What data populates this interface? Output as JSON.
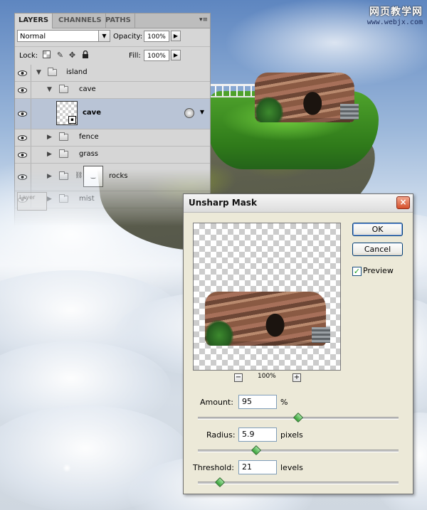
{
  "watermark": {
    "title": "网页教学网",
    "url": "www.webjx.com"
  },
  "layers_panel": {
    "tabs": [
      "LAYERS",
      "CHANNELS",
      "PATHS"
    ],
    "active_tab": "LAYERS",
    "blend_mode": "Normal",
    "opacity_label": "Opacity:",
    "opacity_value": "100%",
    "lock_label": "Lock:",
    "fill_label": "Fill:",
    "fill_value": "100%",
    "layers": [
      {
        "name": "island",
        "type": "group",
        "expanded": true,
        "indent": 0
      },
      {
        "name": "cave",
        "type": "group",
        "expanded": true,
        "indent": 1
      },
      {
        "name": "cave",
        "type": "smart-object",
        "selected": true,
        "indent": 2
      },
      {
        "name": "fence",
        "type": "group",
        "expanded": false,
        "indent": 1
      },
      {
        "name": "grass",
        "type": "group",
        "expanded": false,
        "indent": 1
      },
      {
        "name": "rocks",
        "type": "group-with-mask",
        "expanded": false,
        "indent": 1
      },
      {
        "name": "mist",
        "type": "group",
        "expanded": false,
        "indent": 1
      }
    ],
    "ghost_label": "Layer"
  },
  "dialog": {
    "title": "Unsharp Mask",
    "ok_label": "OK",
    "cancel_label": "Cancel",
    "preview_label": "Preview",
    "preview_checked": true,
    "zoom_value": "100%",
    "zoom_out_glyph": "−",
    "zoom_in_glyph": "+",
    "amount": {
      "label": "Amount:",
      "value": "95",
      "unit": "%",
      "slider_fraction": 0.5
    },
    "radius": {
      "label": "Radius:",
      "value": "5.9",
      "unit": "pixels",
      "slider_fraction": 0.29
    },
    "threshold": {
      "label": "Threshold:",
      "value": "21",
      "unit": "levels",
      "slider_fraction": 0.11
    }
  },
  "icons": {
    "close": "×",
    "panel_menu": "▾≡",
    "eye": "eye-icon"
  },
  "colors": {
    "sky_top": "#5e86c0",
    "grass": "#4fa32c",
    "dialog_bg": "#ece9d8",
    "selected_layer": "#b9c4d6",
    "slider_thumb": "#37a337"
  }
}
